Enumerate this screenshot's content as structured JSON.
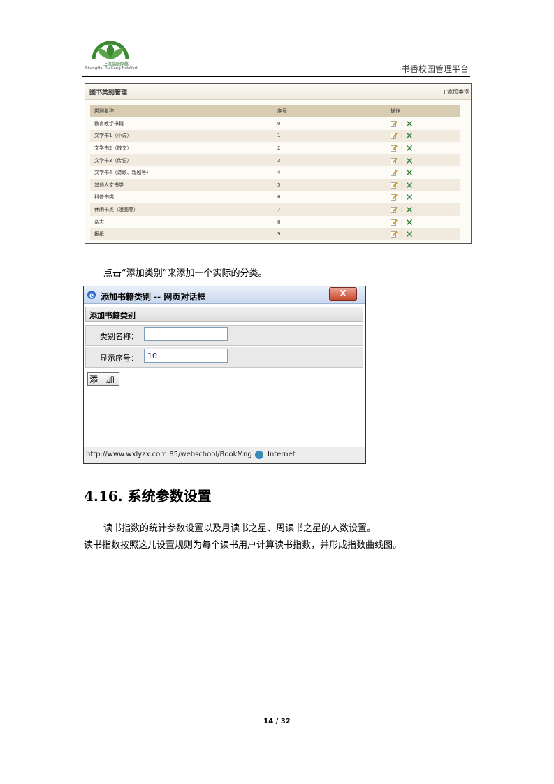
{
  "header": {
    "logo_cn": "上海瑞聪网络",
    "logo_en": "ShangHai RuiCong NetWork",
    "title": "书香校园管理平台"
  },
  "category_panel": {
    "title": "图书类别管理",
    "add_link": "+添加类别",
    "columns": [
      "类别名称",
      "序号",
      "操作"
    ],
    "rows": [
      {
        "name": "教育教学书籍",
        "order": "0"
      },
      {
        "name": "文学书1（小说）",
        "order": "1"
      },
      {
        "name": "文学书2（散文）",
        "order": "2"
      },
      {
        "name": "文学书3（传记）",
        "order": "3"
      },
      {
        "name": "文学书4（诗歌、戏剧等）",
        "order": "4"
      },
      {
        "name": "其他人文书类",
        "order": "5"
      },
      {
        "name": "科普书类",
        "order": "6"
      },
      {
        "name": "休闲书类（漫画等）",
        "order": "7"
      },
      {
        "name": "杂志",
        "order": "8"
      },
      {
        "name": "报纸",
        "order": "9"
      }
    ],
    "separator": "|"
  },
  "intro_text": "点击“添加类别”来添加一个实际的分类。",
  "dialog": {
    "title": "添加书籍类别 -- 网页对话框",
    "close_label": "X",
    "form_title": "添加书籍类别",
    "name_label": "类别名称：",
    "name_value": "",
    "order_label": "显示序号：",
    "order_value": "10",
    "add_button": "添 加",
    "status_url": "http://www.wxlyzx.com:85/webschool/BookMng",
    "status_zone": "Internet"
  },
  "section": {
    "heading": "4.16. 系统参数设置",
    "para1": "读书指数的统计参数设置以及月读书之星、周读书之星的人数设置。",
    "para2": "读书指数按照这儿设置规则为每个读书用户计算读书指数，并形成指数曲线图。"
  },
  "footer": {
    "page": "14 / 32"
  },
  "colors": {
    "table_header": "#d8ccb2",
    "row_alt": "#f0ebde",
    "logo_green": "#3c8a32",
    "delete_green": "#2f7d32"
  }
}
